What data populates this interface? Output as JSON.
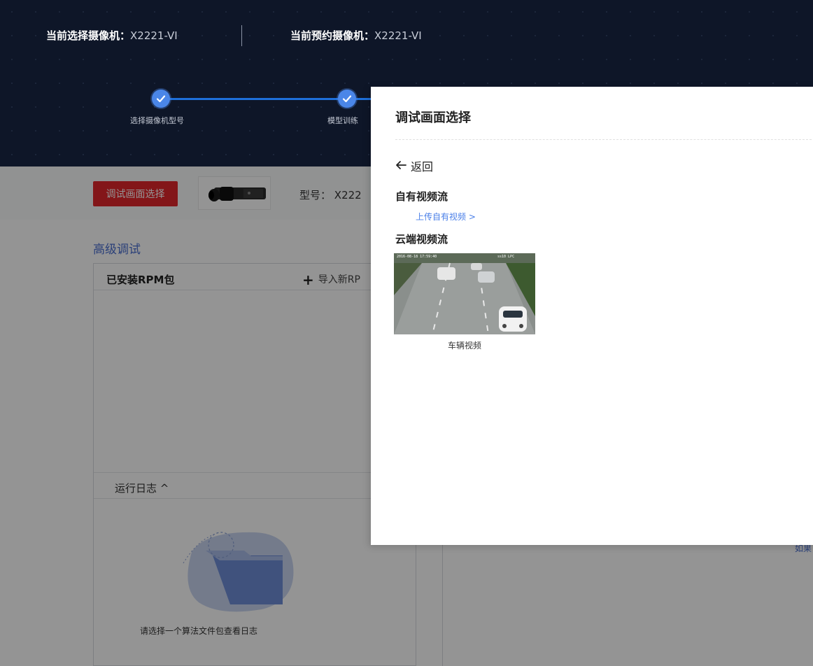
{
  "header": {
    "current_camera_label": "当前选择摄像机：",
    "current_camera_value": "X2221-VI",
    "reserved_camera_label": "当前预约摄像机：",
    "reserved_camera_value": "X2221-VI",
    "steps": [
      {
        "label": "选择摄像机型号",
        "status": "done"
      },
      {
        "label": "模型训练",
        "status": "done"
      }
    ]
  },
  "toolbar": {
    "debug_button_label": "调试画面选择",
    "model_label": "型号：",
    "model_value": "X222"
  },
  "advanced": {
    "title": "高级调试",
    "installed_title": "已安装RPM包",
    "import_label": "导入新RP",
    "log_title": "运行日志 ^",
    "empty_text": "请选择一个算法文件包查看日志"
  },
  "right_hint": "如果",
  "drawer": {
    "title": "调试画面选择",
    "back_label": "返回",
    "own_stream_title": "自有视频流",
    "upload_link": "上传自有视频 >",
    "cloud_stream_title": "云端视频流",
    "video_caption": "车辆视频",
    "video_overlay_left": "2016-08-18 17:59:40",
    "video_overlay_right": "ss10 LPC"
  },
  "colors": {
    "header_bg": "#0e1628",
    "accent_blue": "#1e6fd9",
    "danger_red": "#e2262b",
    "link_blue": "#4a7fe8"
  }
}
